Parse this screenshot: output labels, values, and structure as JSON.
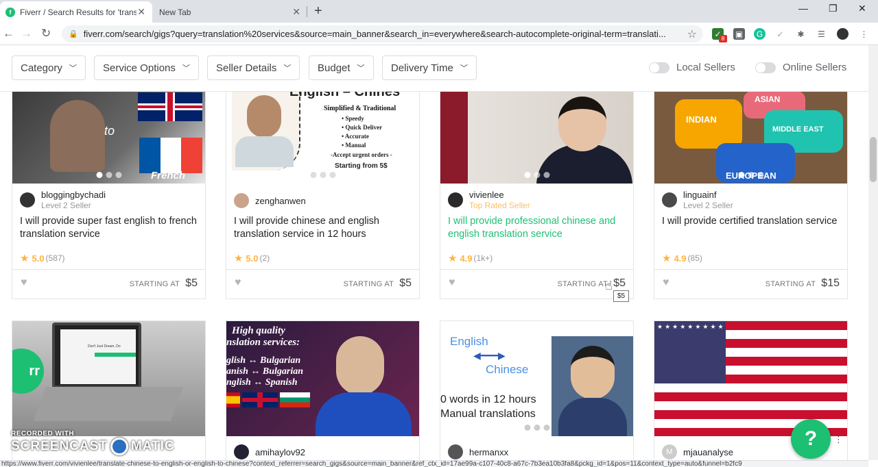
{
  "browser": {
    "tabs": [
      {
        "title": "Fiverr / Search Results for 'transla",
        "active": true
      },
      {
        "title": "New Tab",
        "active": false
      }
    ],
    "url": "fiverr.com/search/gigs?query=translation%20services&source=main_banner&search_in=everywhere&search-autocomplete-original-term=translati...",
    "extension_badge": "8"
  },
  "filters": {
    "items": [
      "Category",
      "Service Options",
      "Seller Details",
      "Budget",
      "Delivery Time"
    ],
    "toggles": [
      "Local Sellers",
      "Online Sellers"
    ]
  },
  "cards": [
    {
      "seller": "bloggingbychadi",
      "level": "Level 2 Seller",
      "title": "I will provide super fast english to french translation service",
      "rating": "5.0",
      "count": "(587)",
      "starting": "STARTING AT",
      "price": "$5",
      "img_text": [
        "to",
        "French"
      ]
    },
    {
      "seller": "zenghanwen",
      "level": "",
      "title": "I will provide chinese and english translation service in 12 hours",
      "rating": "5.0",
      "count": "(2)",
      "starting": "STARTING AT",
      "price": "$5",
      "img_text": [
        "English – Chines",
        "Simplified & Traditional",
        "• Speedy",
        "• Quick Deliver",
        "• Accurate",
        "• Manual",
        "-Accept urgent orders -",
        "Starting from 5$"
      ]
    },
    {
      "seller": "vivienlee",
      "level": "Top Rated Seller",
      "title": "I will provide professional chinese and english translation service",
      "rating": "4.9",
      "count": "(1k+)",
      "starting": "STARTING AT",
      "price": "$5",
      "img_text": []
    },
    {
      "seller": "linguainf",
      "level": "Level 2 Seller",
      "title": "I will provide certified translation service",
      "rating": "4.9",
      "count": "(85)",
      "starting": "STARTING AT",
      "price": "$15",
      "img_text": [
        "ASIAN",
        "INDIAN",
        "MIDDLE EAST",
        "EUROPEAN"
      ]
    },
    {
      "seller": "",
      "level": "",
      "img_text": [
        "rr",
        "Don't Just Dream, Do"
      ]
    },
    {
      "seller": "amihaylov92",
      "level": "",
      "img_text": [
        "High quality",
        "nslation services:",
        "glish ↔ Bulgarian",
        "anish ↔ Bulgarian",
        "nglish ↔ Spanish"
      ]
    },
    {
      "seller": "hermanxx",
      "level": "",
      "img_text": [
        "English",
        "Chinese",
        "0 words in 12 hours",
        "Manual translations"
      ]
    },
    {
      "seller": "mjauanalyse",
      "level": "",
      "avatar_letter": "M",
      "img_text": []
    }
  ],
  "tooltip": "$5",
  "help": "?",
  "status_url": "https://www.fiverr.com/vivienlee/translate-chinese-to-english-or-english-to-chinese?context_referrer=search_gigs&source=main_banner&ref_ctx_id=17ae99a-c107-40c8-a67c-7b3ea10b3fa8&pckg_id=1&pos=11&context_type=auto&funnel=b2fc9",
  "watermark": {
    "line1": "RECORDED WITH",
    "left": "SCREENCAST",
    "right": "MATIC"
  },
  "colors": {
    "brand": "#1dbf73",
    "star": "#ffb33e",
    "top_rated": "#ffbe5b"
  }
}
